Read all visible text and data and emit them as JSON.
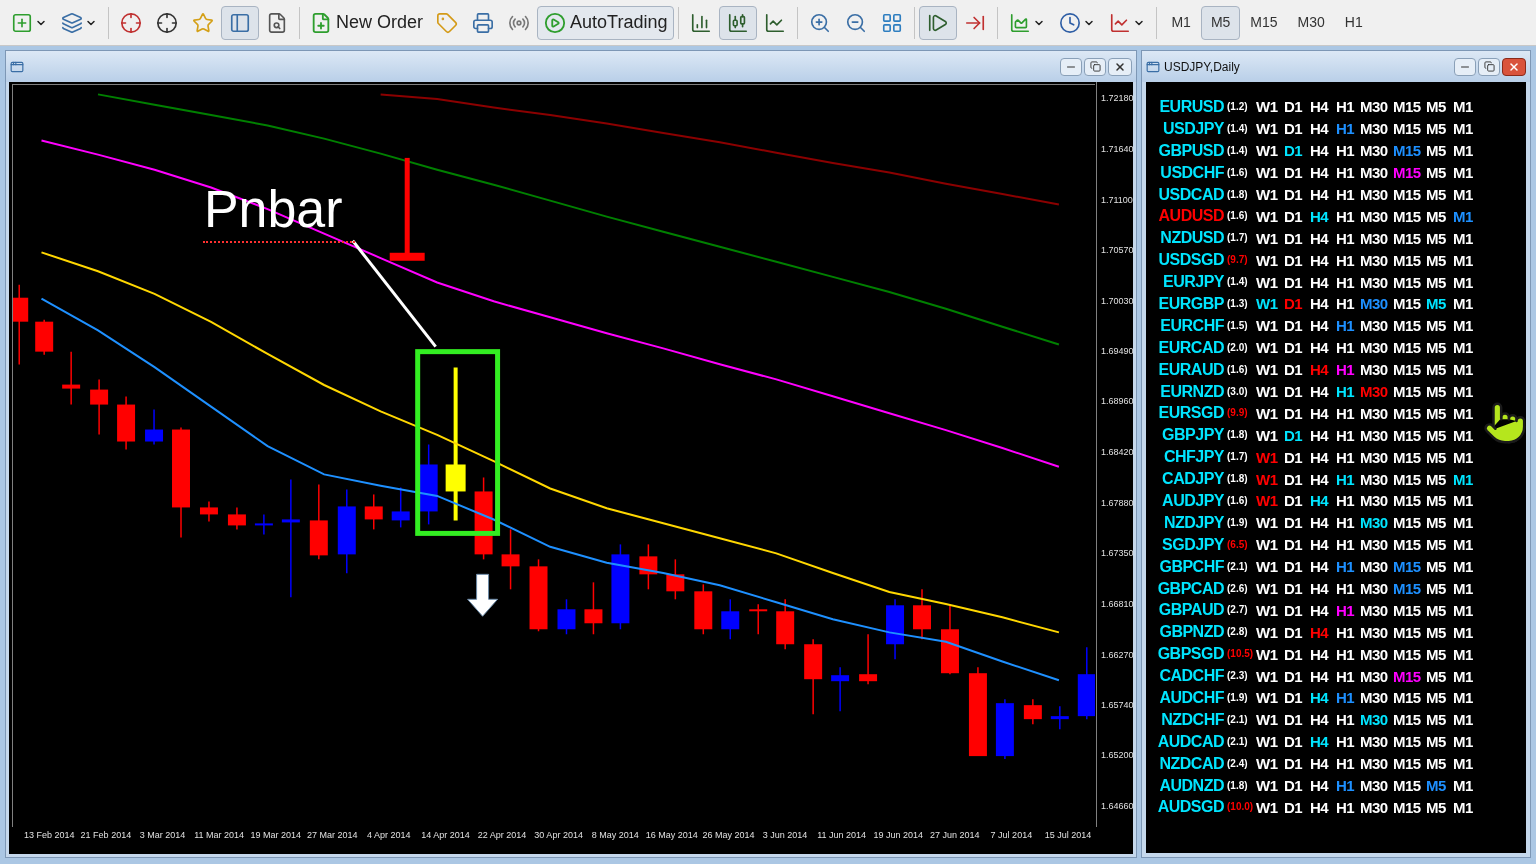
{
  "toolbar": {
    "new_order": "New Order",
    "autotrading": "AutoTrading",
    "timeframes": [
      {
        "label": "M1",
        "selected": false
      },
      {
        "label": "M5",
        "selected": true
      },
      {
        "label": "M15",
        "selected": false
      },
      {
        "label": "M30",
        "selected": false
      },
      {
        "label": "H1",
        "selected": false
      }
    ]
  },
  "chart_window": {
    "annotation": "Pnbar",
    "chart_data": {
      "type": "line",
      "x": [
        "13 Feb 2014",
        "21 Feb 2014",
        "3 Mar 2014",
        "11 Mar 2014",
        "19 Mar 2014",
        "27 Mar 2014",
        "4 Apr 2014",
        "14 Apr 2014",
        "22 Apr 2014",
        "30 Apr 2014",
        "8 May 2014",
        "16 May 2014",
        "26 May 2014",
        "3 Jun 2014",
        "11 Jun 2014",
        "19 Jun 2014",
        "27 Jun 2014",
        "7 Jul 2014",
        "15 Jul 2014"
      ],
      "ylim": [
        1.6445,
        1.7234
      ],
      "yticks": [
        {
          "value": 1.7218,
          "label": "1.72180"
        },
        {
          "value": 1.7164,
          "label": "1.71640"
        },
        {
          "value": 1.711,
          "label": "1.71100"
        },
        {
          "value": 1.7057,
          "label": "1.70570"
        },
        {
          "value": 1.7003,
          "label": "1.70030"
        },
        {
          "value": 1.6949,
          "label": "1.69490"
        },
        {
          "value": 1.6896,
          "label": "1.68960"
        },
        {
          "value": 1.6842,
          "label": "1.68420"
        },
        {
          "value": 1.6788,
          "label": "1.67880"
        },
        {
          "value": 1.6735,
          "label": "1.67350"
        },
        {
          "value": 1.6681,
          "label": "1.66810"
        },
        {
          "value": 1.6627,
          "label": "1.66270"
        },
        {
          "value": 1.6574,
          "label": "1.65740"
        },
        {
          "value": 1.652,
          "label": "1.65200"
        },
        {
          "value": 1.6466,
          "label": "1.64660"
        }
      ],
      "series": [
        {
          "color": "#8b0000",
          "values": [
            null,
            null,
            null,
            null,
            null,
            null,
            1.7224,
            1.7219,
            1.721,
            1.7202,
            1.7193,
            1.7183,
            1.7173,
            1.7162,
            1.7151,
            1.7141,
            1.7129,
            1.7118,
            1.7107
          ]
        },
        {
          "color": "#008000",
          "values": [
            null,
            1.7224,
            1.7213,
            1.7202,
            1.7191,
            1.7177,
            1.7161,
            1.7144,
            1.7128,
            1.7111,
            1.7094,
            1.7078,
            1.7062,
            1.7046,
            1.703,
            1.7014,
            1.6996,
            1.6977,
            1.6958
          ]
        },
        {
          "color": "#ff00ff",
          "values": [
            1.7175,
            1.716,
            1.7144,
            1.7125,
            1.7102,
            1.7076,
            1.705,
            1.7024,
            1.7004,
            1.6987,
            1.697,
            1.6954,
            1.6937,
            1.6921,
            1.6903,
            1.6885,
            1.6867,
            1.6848,
            1.6828
          ]
        },
        {
          "color": "#ffd700",
          "values": [
            1.7056,
            1.7036,
            1.7012,
            1.6982,
            1.6948,
            1.6915,
            1.6887,
            1.6862,
            1.6834,
            1.6805,
            1.6784,
            1.6768,
            1.6752,
            1.6736,
            1.6715,
            1.6695,
            1.6682,
            1.6668,
            1.6652
          ]
        },
        {
          "color": "#1e90ff",
          "values": [
            1.7007,
            1.6973,
            1.6934,
            1.6892,
            1.685,
            1.682,
            1.6808,
            1.6797,
            1.6772,
            1.6743,
            1.6726,
            1.6715,
            1.6702,
            1.6684,
            1.6666,
            1.6652,
            1.6642,
            1.6621,
            1.6601
          ]
        }
      ]
    }
  },
  "watch_window": {
    "title": "USDJPY,Daily",
    "rows": [
      {
        "pair": {
          "text": "EURUSD",
          "color": "#00e5ff"
        },
        "spread": {
          "text": "(1.2)",
          "color": "#ffffff"
        },
        "cells": [
          {
            "label": "W1",
            "color": "#ffffff"
          },
          {
            "label": "D1",
            "color": "#ffffff"
          },
          {
            "label": "H4",
            "color": "#ffffff"
          },
          {
            "label": "H1",
            "color": "#ffffff"
          },
          {
            "label": "M30",
            "color": "#ffffff"
          },
          {
            "label": "M15",
            "color": "#ffffff"
          },
          {
            "label": "M5",
            "color": "#ffffff"
          },
          {
            "label": "M1",
            "color": "#ffffff"
          }
        ]
      },
      {
        "pair": {
          "text": "USDJPY",
          "color": "#00e5ff"
        },
        "spread": {
          "text": "(1.4)",
          "color": "#ffffff"
        },
        "cells": [
          {
            "label": "W1",
            "color": "#ffffff"
          },
          {
            "label": "D1",
            "color": "#ffffff"
          },
          {
            "label": "H4",
            "color": "#ffffff"
          },
          {
            "label": "H1",
            "color": "#1e90ff"
          },
          {
            "label": "M30",
            "color": "#ffffff"
          },
          {
            "label": "M15",
            "color": "#ffffff"
          },
          {
            "label": "M5",
            "color": "#ffffff"
          },
          {
            "label": "M1",
            "color": "#ffffff"
          }
        ]
      },
      {
        "pair": {
          "text": "GBPUSD",
          "color": "#00e5ff"
        },
        "spread": {
          "text": "(1.4)",
          "color": "#ffffff"
        },
        "cells": [
          {
            "label": "W1",
            "color": "#ffffff"
          },
          {
            "label": "D1",
            "color": "#00e5ff"
          },
          {
            "label": "H4",
            "color": "#ffffff"
          },
          {
            "label": "H1",
            "color": "#ffffff"
          },
          {
            "label": "M30",
            "color": "#ffffff"
          },
          {
            "label": "M15",
            "color": "#1e90ff"
          },
          {
            "label": "M5",
            "color": "#ffffff"
          },
          {
            "label": "M1",
            "color": "#ffffff"
          }
        ]
      },
      {
        "pair": {
          "text": "USDCHF",
          "color": "#00e5ff"
        },
        "spread": {
          "text": "(1.6)",
          "color": "#ffffff"
        },
        "cells": [
          {
            "label": "W1",
            "color": "#ffffff"
          },
          {
            "label": "D1",
            "color": "#ffffff"
          },
          {
            "label": "H4",
            "color": "#ffffff"
          },
          {
            "label": "H1",
            "color": "#ffffff"
          },
          {
            "label": "M30",
            "color": "#ffffff"
          },
          {
            "label": "M15",
            "color": "#ff00ff"
          },
          {
            "label": "M5",
            "color": "#ffffff"
          },
          {
            "label": "M1",
            "color": "#ffffff"
          }
        ]
      },
      {
        "pair": {
          "text": "USDCAD",
          "color": "#00e5ff"
        },
        "spread": {
          "text": "(1.8)",
          "color": "#ffffff"
        },
        "cells": [
          {
            "label": "W1",
            "color": "#ffffff"
          },
          {
            "label": "D1",
            "color": "#ffffff"
          },
          {
            "label": "H4",
            "color": "#ffffff"
          },
          {
            "label": "H1",
            "color": "#ffffff"
          },
          {
            "label": "M30",
            "color": "#ffffff"
          },
          {
            "label": "M15",
            "color": "#ffffff"
          },
          {
            "label": "M5",
            "color": "#ffffff"
          },
          {
            "label": "M1",
            "color": "#ffffff"
          }
        ]
      },
      {
        "pair": {
          "text": "AUDUSD",
          "color": "#ff0000"
        },
        "spread": {
          "text": "(1.6)",
          "color": "#ffffff"
        },
        "cells": [
          {
            "label": "W1",
            "color": "#ffffff"
          },
          {
            "label": "D1",
            "color": "#ffffff"
          },
          {
            "label": "H4",
            "color": "#00e5ff"
          },
          {
            "label": "H1",
            "color": "#ffffff"
          },
          {
            "label": "M30",
            "color": "#ffffff"
          },
          {
            "label": "M15",
            "color": "#ffffff"
          },
          {
            "label": "M5",
            "color": "#ffffff"
          },
          {
            "label": "M1",
            "color": "#1e90ff"
          }
        ]
      },
      {
        "pair": {
          "text": "NZDUSD",
          "color": "#00e5ff"
        },
        "spread": {
          "text": "(1.7)",
          "color": "#ffffff"
        },
        "cells": [
          {
            "label": "W1",
            "color": "#ffffff"
          },
          {
            "label": "D1",
            "color": "#ffffff"
          },
          {
            "label": "H4",
            "color": "#ffffff"
          },
          {
            "label": "H1",
            "color": "#ffffff"
          },
          {
            "label": "M30",
            "color": "#ffffff"
          },
          {
            "label": "M15",
            "color": "#ffffff"
          },
          {
            "label": "M5",
            "color": "#ffffff"
          },
          {
            "label": "M1",
            "color": "#ffffff"
          }
        ]
      },
      {
        "pair": {
          "text": "USDSGD",
          "color": "#00e5ff"
        },
        "spread": {
          "text": "(9.7)",
          "color": "#ff0000"
        },
        "cells": [
          {
            "label": "W1",
            "color": "#ffffff"
          },
          {
            "label": "D1",
            "color": "#ffffff"
          },
          {
            "label": "H4",
            "color": "#ffffff"
          },
          {
            "label": "H1",
            "color": "#ffffff"
          },
          {
            "label": "M30",
            "color": "#ffffff"
          },
          {
            "label": "M15",
            "color": "#ffffff"
          },
          {
            "label": "M5",
            "color": "#ffffff"
          },
          {
            "label": "M1",
            "color": "#ffffff"
          }
        ]
      },
      {
        "pair": {
          "text": "EURJPY",
          "color": "#00e5ff"
        },
        "spread": {
          "text": "(1.4)",
          "color": "#ffffff"
        },
        "cells": [
          {
            "label": "W1",
            "color": "#ffffff"
          },
          {
            "label": "D1",
            "color": "#ffffff"
          },
          {
            "label": "H4",
            "color": "#ffffff"
          },
          {
            "label": "H1",
            "color": "#ffffff"
          },
          {
            "label": "M30",
            "color": "#ffffff"
          },
          {
            "label": "M15",
            "color": "#ffffff"
          },
          {
            "label": "M5",
            "color": "#ffffff"
          },
          {
            "label": "M1",
            "color": "#ffffff"
          }
        ]
      },
      {
        "pair": {
          "text": "EURGBP",
          "color": "#00e5ff"
        },
        "spread": {
          "text": "(1.3)",
          "color": "#ffffff"
        },
        "cells": [
          {
            "label": "W1",
            "color": "#00e5ff"
          },
          {
            "label": "D1",
            "color": "#ff0000"
          },
          {
            "label": "H4",
            "color": "#ffffff"
          },
          {
            "label": "H1",
            "color": "#ffffff"
          },
          {
            "label": "M30",
            "color": "#1e90ff"
          },
          {
            "label": "M15",
            "color": "#ffffff"
          },
          {
            "label": "M5",
            "color": "#00e5ff"
          },
          {
            "label": "M1",
            "color": "#ffffff"
          }
        ]
      },
      {
        "pair": {
          "text": "EURCHF",
          "color": "#00e5ff"
        },
        "spread": {
          "text": "(1.5)",
          "color": "#ffffff"
        },
        "cells": [
          {
            "label": "W1",
            "color": "#ffffff"
          },
          {
            "label": "D1",
            "color": "#ffffff"
          },
          {
            "label": "H4",
            "color": "#ffffff"
          },
          {
            "label": "H1",
            "color": "#1e90ff"
          },
          {
            "label": "M30",
            "color": "#ffffff"
          },
          {
            "label": "M15",
            "color": "#ffffff"
          },
          {
            "label": "M5",
            "color": "#ffffff"
          },
          {
            "label": "M1",
            "color": "#ffffff"
          }
        ]
      },
      {
        "pair": {
          "text": "EURCAD",
          "color": "#00e5ff"
        },
        "spread": {
          "text": "(2.0)",
          "color": "#ffffff"
        },
        "cells": [
          {
            "label": "W1",
            "color": "#ffffff"
          },
          {
            "label": "D1",
            "color": "#ffffff"
          },
          {
            "label": "H4",
            "color": "#ffffff"
          },
          {
            "label": "H1",
            "color": "#ffffff"
          },
          {
            "label": "M30",
            "color": "#ffffff"
          },
          {
            "label": "M15",
            "color": "#ffffff"
          },
          {
            "label": "M5",
            "color": "#ffffff"
          },
          {
            "label": "M1",
            "color": "#ffffff"
          }
        ]
      },
      {
        "pair": {
          "text": "EURAUD",
          "color": "#00e5ff"
        },
        "spread": {
          "text": "(1.6)",
          "color": "#ffffff"
        },
        "cells": [
          {
            "label": "W1",
            "color": "#ffffff"
          },
          {
            "label": "D1",
            "color": "#ffffff"
          },
          {
            "label": "H4",
            "color": "#ff0000"
          },
          {
            "label": "H1",
            "color": "#ff00ff"
          },
          {
            "label": "M30",
            "color": "#ffffff"
          },
          {
            "label": "M15",
            "color": "#ffffff"
          },
          {
            "label": "M5",
            "color": "#ffffff"
          },
          {
            "label": "M1",
            "color": "#ffffff"
          }
        ]
      },
      {
        "pair": {
          "text": "EURNZD",
          "color": "#00e5ff"
        },
        "spread": {
          "text": "(3.0)",
          "color": "#ffffff"
        },
        "cells": [
          {
            "label": "W1",
            "color": "#ffffff"
          },
          {
            "label": "D1",
            "color": "#ffffff"
          },
          {
            "label": "H4",
            "color": "#ffffff"
          },
          {
            "label": "H1",
            "color": "#00e5ff"
          },
          {
            "label": "M30",
            "color": "#ff0000"
          },
          {
            "label": "M15",
            "color": "#ffffff"
          },
          {
            "label": "M5",
            "color": "#ffffff"
          },
          {
            "label": "M1",
            "color": "#ffffff"
          }
        ]
      },
      {
        "pair": {
          "text": "EURSGD",
          "color": "#00e5ff"
        },
        "spread": {
          "text": "(9.9)",
          "color": "#ff0000"
        },
        "cells": [
          {
            "label": "W1",
            "color": "#ffffff"
          },
          {
            "label": "D1",
            "color": "#ffffff"
          },
          {
            "label": "H4",
            "color": "#ffffff"
          },
          {
            "label": "H1",
            "color": "#ffffff"
          },
          {
            "label": "M30",
            "color": "#ffffff"
          },
          {
            "label": "M15",
            "color": "#ffffff"
          },
          {
            "label": "M5",
            "color": "#ffffff"
          },
          {
            "label": "M1",
            "color": "#ffffff"
          }
        ]
      },
      {
        "pair": {
          "text": "GBPJPY",
          "color": "#00e5ff"
        },
        "spread": {
          "text": "(1.8)",
          "color": "#ffffff"
        },
        "cells": [
          {
            "label": "W1",
            "color": "#ffffff"
          },
          {
            "label": "D1",
            "color": "#00e5ff"
          },
          {
            "label": "H4",
            "color": "#ffffff"
          },
          {
            "label": "H1",
            "color": "#ffffff"
          },
          {
            "label": "M30",
            "color": "#ffffff"
          },
          {
            "label": "M15",
            "color": "#ffffff"
          },
          {
            "label": "M5",
            "color": "#ffffff"
          },
          {
            "label": "M1",
            "color": "#ffffff"
          }
        ]
      },
      {
        "pair": {
          "text": "CHFJPY",
          "color": "#00e5ff"
        },
        "spread": {
          "text": "(1.7)",
          "color": "#ffffff"
        },
        "cells": [
          {
            "label": "W1",
            "color": "#ff0000"
          },
          {
            "label": "D1",
            "color": "#ffffff"
          },
          {
            "label": "H4",
            "color": "#ffffff"
          },
          {
            "label": "H1",
            "color": "#ffffff"
          },
          {
            "label": "M30",
            "color": "#ffffff"
          },
          {
            "label": "M15",
            "color": "#ffffff"
          },
          {
            "label": "M5",
            "color": "#ffffff"
          },
          {
            "label": "M1",
            "color": "#ffffff"
          }
        ]
      },
      {
        "pair": {
          "text": "CADJPY",
          "color": "#00e5ff"
        },
        "spread": {
          "text": "(1.8)",
          "color": "#ffffff"
        },
        "cells": [
          {
            "label": "W1",
            "color": "#ff0000"
          },
          {
            "label": "D1",
            "color": "#ffffff"
          },
          {
            "label": "H4",
            "color": "#ffffff"
          },
          {
            "label": "H1",
            "color": "#00e5ff"
          },
          {
            "label": "M30",
            "color": "#ffffff"
          },
          {
            "label": "M15",
            "color": "#ffffff"
          },
          {
            "label": "M5",
            "color": "#ffffff"
          },
          {
            "label": "M1",
            "color": "#00e5ff"
          }
        ]
      },
      {
        "pair": {
          "text": "AUDJPY",
          "color": "#00e5ff"
        },
        "spread": {
          "text": "(1.6)",
          "color": "#ffffff"
        },
        "cells": [
          {
            "label": "W1",
            "color": "#ff0000"
          },
          {
            "label": "D1",
            "color": "#ffffff"
          },
          {
            "label": "H4",
            "color": "#00e5ff"
          },
          {
            "label": "H1",
            "color": "#ffffff"
          },
          {
            "label": "M30",
            "color": "#ffffff"
          },
          {
            "label": "M15",
            "color": "#ffffff"
          },
          {
            "label": "M5",
            "color": "#ffffff"
          },
          {
            "label": "M1",
            "color": "#ffffff"
          }
        ]
      },
      {
        "pair": {
          "text": "NZDJPY",
          "color": "#00e5ff"
        },
        "spread": {
          "text": "(1.9)",
          "color": "#ffffff"
        },
        "cells": [
          {
            "label": "W1",
            "color": "#ffffff"
          },
          {
            "label": "D1",
            "color": "#ffffff"
          },
          {
            "label": "H4",
            "color": "#ffffff"
          },
          {
            "label": "H1",
            "color": "#ffffff"
          },
          {
            "label": "M30",
            "color": "#00e5ff"
          },
          {
            "label": "M15",
            "color": "#ffffff"
          },
          {
            "label": "M5",
            "color": "#ffffff"
          },
          {
            "label": "M1",
            "color": "#ffffff"
          }
        ]
      },
      {
        "pair": {
          "text": "SGDJPY",
          "color": "#00e5ff"
        },
        "spread": {
          "text": "(6.5)",
          "color": "#ff0000"
        },
        "cells": [
          {
            "label": "W1",
            "color": "#ffffff"
          },
          {
            "label": "D1",
            "color": "#ffffff"
          },
          {
            "label": "H4",
            "color": "#ffffff"
          },
          {
            "label": "H1",
            "color": "#ffffff"
          },
          {
            "label": "M30",
            "color": "#ffffff"
          },
          {
            "label": "M15",
            "color": "#ffffff"
          },
          {
            "label": "M5",
            "color": "#ffffff"
          },
          {
            "label": "M1",
            "color": "#ffffff"
          }
        ]
      },
      {
        "pair": {
          "text": "GBPCHF",
          "color": "#00e5ff"
        },
        "spread": {
          "text": "(2.1)",
          "color": "#ffffff"
        },
        "cells": [
          {
            "label": "W1",
            "color": "#ffffff"
          },
          {
            "label": "D1",
            "color": "#ffffff"
          },
          {
            "label": "H4",
            "color": "#ffffff"
          },
          {
            "label": "H1",
            "color": "#1e90ff"
          },
          {
            "label": "M30",
            "color": "#ffffff"
          },
          {
            "label": "M15",
            "color": "#1e90ff"
          },
          {
            "label": "M5",
            "color": "#ffffff"
          },
          {
            "label": "M1",
            "color": "#ffffff"
          }
        ]
      },
      {
        "pair": {
          "text": "GBPCAD",
          "color": "#00e5ff"
        },
        "spread": {
          "text": "(2.6)",
          "color": "#ffffff"
        },
        "cells": [
          {
            "label": "W1",
            "color": "#ffffff"
          },
          {
            "label": "D1",
            "color": "#ffffff"
          },
          {
            "label": "H4",
            "color": "#ffffff"
          },
          {
            "label": "H1",
            "color": "#ffffff"
          },
          {
            "label": "M30",
            "color": "#ffffff"
          },
          {
            "label": "M15",
            "color": "#1e90ff"
          },
          {
            "label": "M5",
            "color": "#ffffff"
          },
          {
            "label": "M1",
            "color": "#ffffff"
          }
        ]
      },
      {
        "pair": {
          "text": "GBPAUD",
          "color": "#00e5ff"
        },
        "spread": {
          "text": "(2.7)",
          "color": "#ffffff"
        },
        "cells": [
          {
            "label": "W1",
            "color": "#ffffff"
          },
          {
            "label": "D1",
            "color": "#ffffff"
          },
          {
            "label": "H4",
            "color": "#ffffff"
          },
          {
            "label": "H1",
            "color": "#ff00ff"
          },
          {
            "label": "M30",
            "color": "#ffffff"
          },
          {
            "label": "M15",
            "color": "#ffffff"
          },
          {
            "label": "M5",
            "color": "#ffffff"
          },
          {
            "label": "M1",
            "color": "#ffffff"
          }
        ]
      },
      {
        "pair": {
          "text": "GBPNZD",
          "color": "#00e5ff"
        },
        "spread": {
          "text": "(2.8)",
          "color": "#ffffff"
        },
        "cells": [
          {
            "label": "W1",
            "color": "#ffffff"
          },
          {
            "label": "D1",
            "color": "#ffffff"
          },
          {
            "label": "H4",
            "color": "#ff0000"
          },
          {
            "label": "H1",
            "color": "#ffffff"
          },
          {
            "label": "M30",
            "color": "#ffffff"
          },
          {
            "label": "M15",
            "color": "#ffffff"
          },
          {
            "label": "M5",
            "color": "#ffffff"
          },
          {
            "label": "M1",
            "color": "#ffffff"
          }
        ]
      },
      {
        "pair": {
          "text": "GBPSGD",
          "color": "#00e5ff"
        },
        "spread": {
          "text": "(10.5)",
          "color": "#ff0000"
        },
        "cells": [
          {
            "label": "W1",
            "color": "#ffffff"
          },
          {
            "label": "D1",
            "color": "#ffffff"
          },
          {
            "label": "H4",
            "color": "#ffffff"
          },
          {
            "label": "H1",
            "color": "#ffffff"
          },
          {
            "label": "M30",
            "color": "#ffffff"
          },
          {
            "label": "M15",
            "color": "#ffffff"
          },
          {
            "label": "M5",
            "color": "#ffffff"
          },
          {
            "label": "M1",
            "color": "#ffffff"
          }
        ]
      },
      {
        "pair": {
          "text": "CADCHF",
          "color": "#00e5ff"
        },
        "spread": {
          "text": "(2.3)",
          "color": "#ffffff"
        },
        "cells": [
          {
            "label": "W1",
            "color": "#ffffff"
          },
          {
            "label": "D1",
            "color": "#ffffff"
          },
          {
            "label": "H4",
            "color": "#ffffff"
          },
          {
            "label": "H1",
            "color": "#ffffff"
          },
          {
            "label": "M30",
            "color": "#ffffff"
          },
          {
            "label": "M15",
            "color": "#ff00ff"
          },
          {
            "label": "M5",
            "color": "#ffffff"
          },
          {
            "label": "M1",
            "color": "#ffffff"
          }
        ]
      },
      {
        "pair": {
          "text": "AUDCHF",
          "color": "#00e5ff"
        },
        "spread": {
          "text": "(1.9)",
          "color": "#ffffff"
        },
        "cells": [
          {
            "label": "W1",
            "color": "#ffffff"
          },
          {
            "label": "D1",
            "color": "#ffffff"
          },
          {
            "label": "H4",
            "color": "#00e5ff"
          },
          {
            "label": "H1",
            "color": "#1e90ff"
          },
          {
            "label": "M30",
            "color": "#ffffff"
          },
          {
            "label": "M15",
            "color": "#ffffff"
          },
          {
            "label": "M5",
            "color": "#ffffff"
          },
          {
            "label": "M1",
            "color": "#ffffff"
          }
        ]
      },
      {
        "pair": {
          "text": "NZDCHF",
          "color": "#00e5ff"
        },
        "spread": {
          "text": "(2.1)",
          "color": "#ffffff"
        },
        "cells": [
          {
            "label": "W1",
            "color": "#ffffff"
          },
          {
            "label": "D1",
            "color": "#ffffff"
          },
          {
            "label": "H4",
            "color": "#ffffff"
          },
          {
            "label": "H1",
            "color": "#ffffff"
          },
          {
            "label": "M30",
            "color": "#00e5ff"
          },
          {
            "label": "M15",
            "color": "#ffffff"
          },
          {
            "label": "M5",
            "color": "#ffffff"
          },
          {
            "label": "M1",
            "color": "#ffffff"
          }
        ]
      },
      {
        "pair": {
          "text": "AUDCAD",
          "color": "#00e5ff"
        },
        "spread": {
          "text": "(2.1)",
          "color": "#ffffff"
        },
        "cells": [
          {
            "label": "W1",
            "color": "#ffffff"
          },
          {
            "label": "D1",
            "color": "#ffffff"
          },
          {
            "label": "H4",
            "color": "#00e5ff"
          },
          {
            "label": "H1",
            "color": "#ffffff"
          },
          {
            "label": "M30",
            "color": "#ffffff"
          },
          {
            "label": "M15",
            "color": "#ffffff"
          },
          {
            "label": "M5",
            "color": "#ffffff"
          },
          {
            "label": "M1",
            "color": "#ffffff"
          }
        ]
      },
      {
        "pair": {
          "text": "NZDCAD",
          "color": "#00e5ff"
        },
        "spread": {
          "text": "(2.4)",
          "color": "#ffffff"
        },
        "cells": [
          {
            "label": "W1",
            "color": "#ffffff"
          },
          {
            "label": "D1",
            "color": "#ffffff"
          },
          {
            "label": "H4",
            "color": "#ffffff"
          },
          {
            "label": "H1",
            "color": "#ffffff"
          },
          {
            "label": "M30",
            "color": "#ffffff"
          },
          {
            "label": "M15",
            "color": "#ffffff"
          },
          {
            "label": "M5",
            "color": "#ffffff"
          },
          {
            "label": "M1",
            "color": "#ffffff"
          }
        ]
      },
      {
        "pair": {
          "text": "AUDNZD",
          "color": "#00e5ff"
        },
        "spread": {
          "text": "(1.8)",
          "color": "#ffffff"
        },
        "cells": [
          {
            "label": "W1",
            "color": "#ffffff"
          },
          {
            "label": "D1",
            "color": "#ffffff"
          },
          {
            "label": "H4",
            "color": "#ffffff"
          },
          {
            "label": "H1",
            "color": "#1e90ff"
          },
          {
            "label": "M30",
            "color": "#ffffff"
          },
          {
            "label": "M15",
            "color": "#ffffff"
          },
          {
            "label": "M5",
            "color": "#1e90ff"
          },
          {
            "label": "M1",
            "color": "#ffffff"
          }
        ]
      },
      {
        "pair": {
          "text": "AUDSGD",
          "color": "#00e5ff"
        },
        "spread": {
          "text": "(10.0)",
          "color": "#ff0000"
        },
        "cells": [
          {
            "label": "W1",
            "color": "#ffffff"
          },
          {
            "label": "D1",
            "color": "#ffffff"
          },
          {
            "label": "H4",
            "color": "#ffffff"
          },
          {
            "label": "H1",
            "color": "#ffffff"
          },
          {
            "label": "M30",
            "color": "#ffffff"
          },
          {
            "label": "M15",
            "color": "#ffffff"
          },
          {
            "label": "M5",
            "color": "#ffffff"
          },
          {
            "label": "M1",
            "color": "#ffffff"
          }
        ]
      }
    ]
  }
}
